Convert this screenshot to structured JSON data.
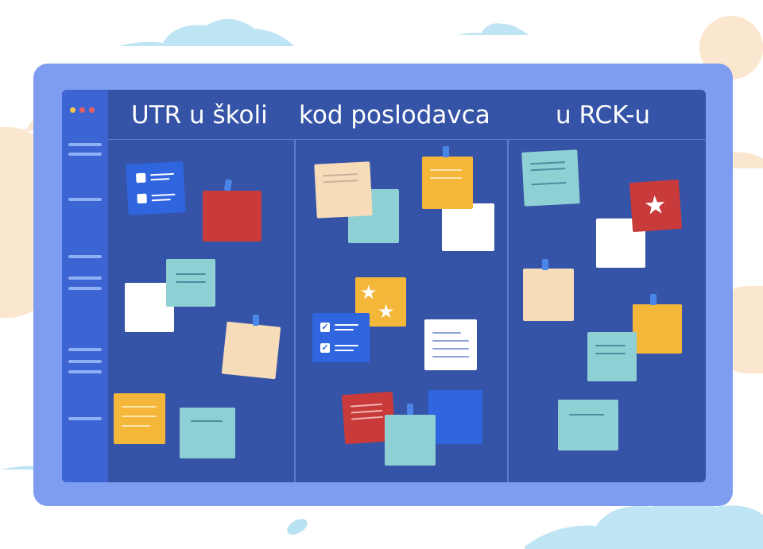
{
  "board": {
    "columns": [
      {
        "title": "UTR u školi"
      },
      {
        "title": "kod poslodavca"
      },
      {
        "title": "u RCK-u"
      }
    ]
  },
  "window_controls": [
    "close-dot",
    "minimize-dot",
    "maximize-dot"
  ],
  "colors": {
    "frame": "#7e9cf0",
    "board": "#3654a7",
    "sidebar": "#3d64d3",
    "note_blue": "#2f66e0",
    "note_red": "#c93a3a",
    "note_teal": "#8fd0d4",
    "note_orange": "#f5b73a",
    "note_cream": "#f6dcb9",
    "note_white": "#ffffff"
  }
}
